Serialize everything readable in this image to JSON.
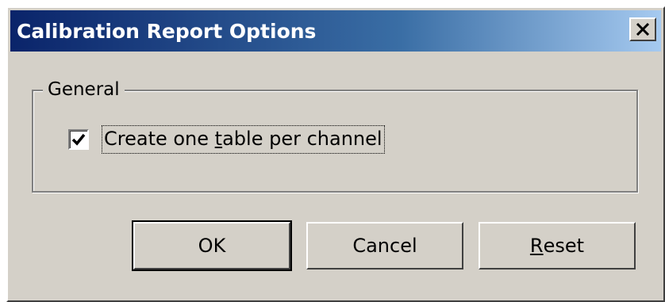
{
  "window": {
    "title": "Calibration Report Options",
    "close_label": "X"
  },
  "general_group": {
    "legend": "General",
    "checkbox": {
      "label_prefix": "Create one ",
      "label_mnemonic": "t",
      "label_suffix": "able per channel",
      "checked": true
    }
  },
  "buttons": {
    "ok": "OK",
    "cancel": "Cancel",
    "reset_mnemonic": "R",
    "reset_rest": "eset"
  },
  "colors": {
    "dialog_face": "#d4d0c8",
    "title_start": "#0a246a",
    "title_end": "#a6caf0"
  }
}
